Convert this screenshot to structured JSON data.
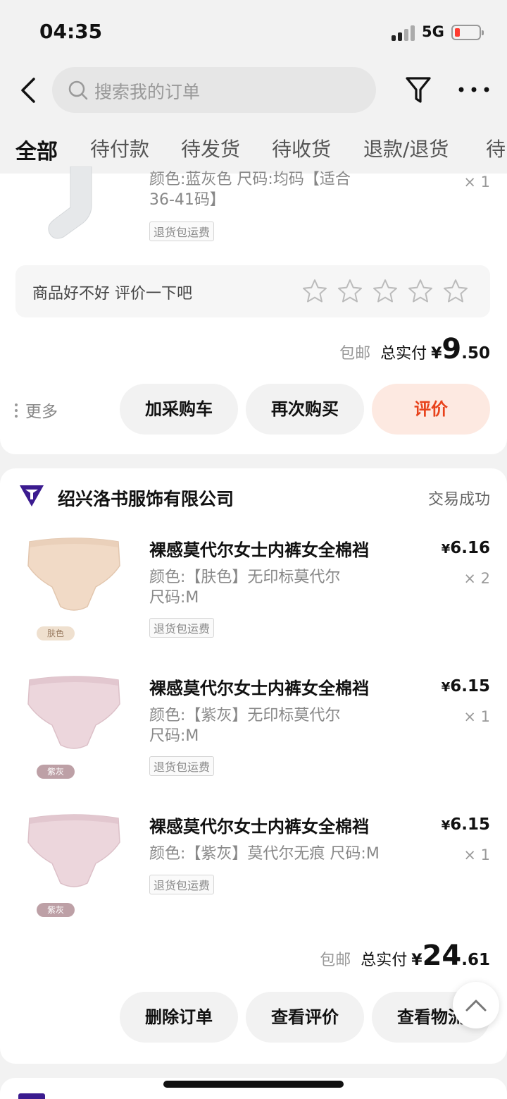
{
  "status_bar": {
    "time": "04:35",
    "network": "5G"
  },
  "header": {
    "search_placeholder": "搜索我的订单",
    "tabs": [
      "全部",
      "待付款",
      "待发货",
      "待收货",
      "退款/退货",
      "待"
    ]
  },
  "order1": {
    "item": {
      "spec": "颜色:蓝灰色 尺码:均码【适合36-41码】",
      "tag": "退货包运费",
      "qty": "× 1"
    },
    "review_prompt": "商品好不好 评价一下吧",
    "shipping": "包邮",
    "total_label": "总实付",
    "currency": "¥",
    "total_int": "9",
    "total_dec": ".50",
    "more": "更多",
    "buttons": {
      "cart": "加采购车",
      "rebuy": "再次购买",
      "review": "评价"
    }
  },
  "order2": {
    "shop_name": "绍兴洛书服饰有限公司",
    "status": "交易成功",
    "items": [
      {
        "title": "裸感莫代尔女士内裤女全棉裆",
        "spec": "颜色:【肤色】无印标莫代尔 尺码:M",
        "tag": "退货包运费",
        "thumb_label": "肤色",
        "price": "6.16",
        "qty": "× 2"
      },
      {
        "title": "裸感莫代尔女士内裤女全棉裆",
        "spec": "颜色:【紫灰】无印标莫代尔 尺码:M",
        "tag": "退货包运费",
        "thumb_label": "紫灰",
        "price": "6.15",
        "qty": "× 1"
      },
      {
        "title": "裸感莫代尔女士内裤女全棉裆",
        "spec": "颜色:【紫灰】莫代尔无痕 尺码:M",
        "tag": "退货包运费",
        "thumb_label": "紫灰",
        "price": "6.15",
        "qty": "× 1"
      }
    ],
    "currency": "¥",
    "shipping": "包邮",
    "total_label": "总实付",
    "total_int": "24",
    "total_dec": ".61",
    "buttons": {
      "delete": "删除订单",
      "view_review": "查看评价",
      "logistics": "查看物流"
    }
  },
  "colors": {
    "accent": "#e8421b",
    "accent_bg": "#fde9e1",
    "logo": "#3b1b8f"
  }
}
